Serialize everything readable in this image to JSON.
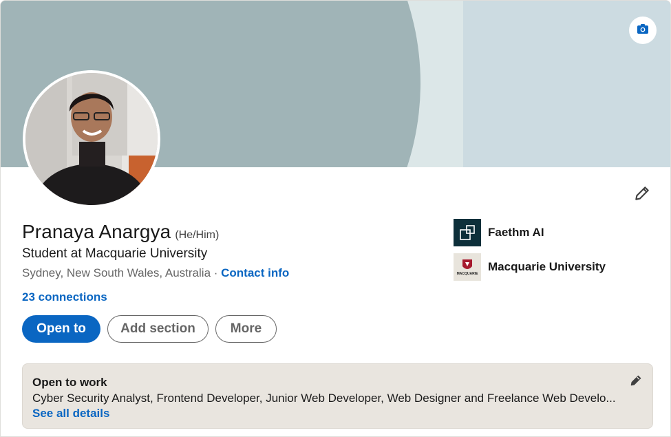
{
  "profile": {
    "name": "Pranaya Anargya",
    "pronouns": "(He/Him)",
    "headline": "Student at Macquarie University",
    "location": "Sydney, New South Wales, Australia",
    "separator": " · ",
    "contact_label": "Contact info",
    "connections_label": "23 connections"
  },
  "actions": {
    "open_to_label": "Open to",
    "add_section_label": "Add section",
    "more_label": "More"
  },
  "orgs": [
    {
      "name": "Faethm AI",
      "logo": "faethm-logo"
    },
    {
      "name": "Macquarie University",
      "logo": "macquarie-logo",
      "logo_text": "MACQUARIE"
    }
  ],
  "open_to_work": {
    "title": "Open to work",
    "roles": "Cyber Security Analyst, Frontend Developer, Junior Web Developer, Web Designer and Freelance Web Develo...",
    "details_link": "See all details"
  },
  "icons": {
    "camera": "camera-icon",
    "edit": "pencil-icon"
  },
  "colors": {
    "accent": "#0a66c2",
    "banner": "#a0b4b7",
    "otw_background": "#e9e5df"
  }
}
